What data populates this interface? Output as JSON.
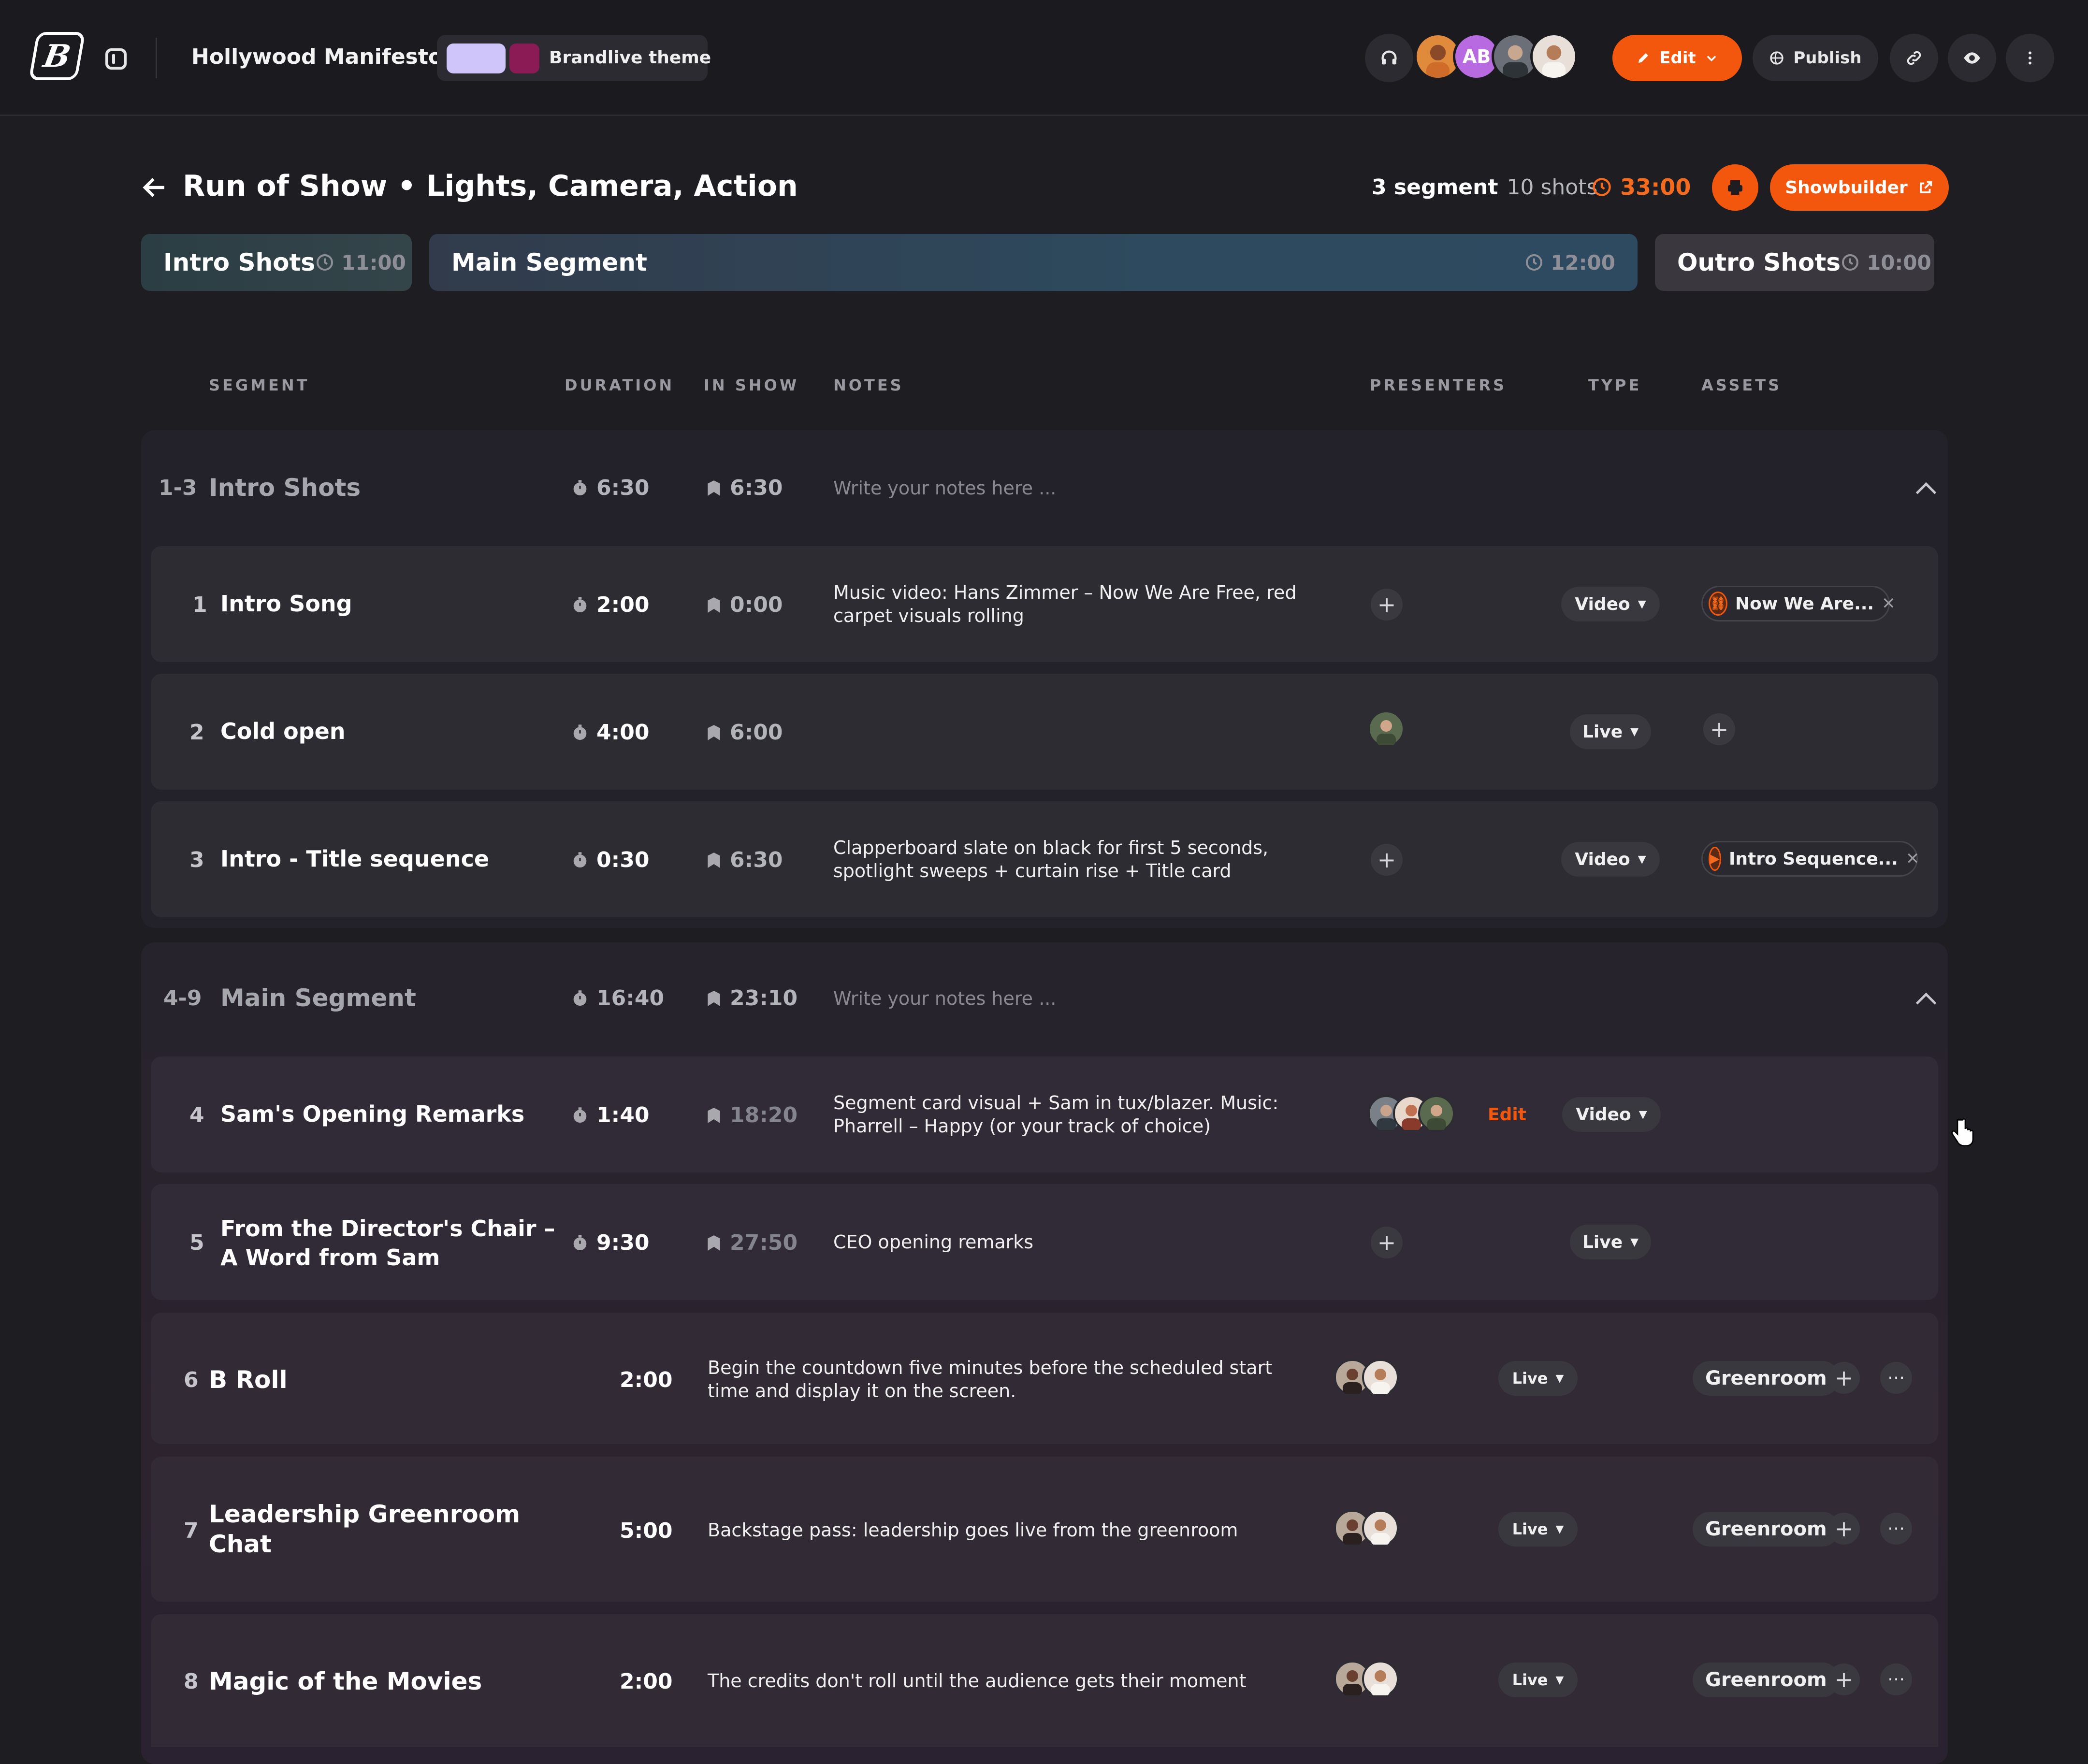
{
  "app": {
    "logo_text": "B",
    "project_title": "Hollywood Manifesto",
    "theme_label": "Brandlive theme",
    "theme_colors": [
      "#d0c5fa",
      "#8a1b55"
    ],
    "avatars": [
      {
        "kind": "photo",
        "color": "#e08a3c"
      },
      {
        "kind": "initials",
        "text": "AB",
        "color": "#b86ae0"
      },
      {
        "kind": "photo",
        "color": "#6a6f78"
      },
      {
        "kind": "photo",
        "color": "#e8e0d8"
      }
    ],
    "edit_label": "Edit",
    "publish_label": "Publish",
    "icons": [
      "headphones-icon",
      "pencil-icon",
      "chevron-down-icon",
      "globe-icon",
      "link-icon",
      "eye-icon",
      "more-vertical-icon"
    ],
    "accent_color": "#f2570d"
  },
  "page": {
    "title": "Run of Show • Lights, Camera, Action",
    "segment_count": "3 segment",
    "shot_count": "10 shots",
    "total_time": "33:00",
    "showbuilder_label": "Showbuilder"
  },
  "segment_tabs": [
    {
      "name": "Intro Shots",
      "time": "11:00"
    },
    {
      "name": "Main Segment",
      "time": "12:00"
    },
    {
      "name": "Outro Shots",
      "time": "10:00"
    }
  ],
  "columns": {
    "segment": "SEGMENT",
    "duration": "DURATION",
    "in_show": "IN SHOW",
    "notes": "NOTES",
    "presenters": "PRESENTERS",
    "type": "TYPE",
    "assets": "ASSETS"
  },
  "groups": [
    {
      "range": "1-3",
      "name": "Intro Shots",
      "duration": "6:30",
      "in_show": "6:30",
      "notes_placeholder": "Write your notes here ..."
    },
    {
      "range": "4-9",
      "name": "Main Segment",
      "duration": "16:40",
      "in_show": "23:10",
      "notes_placeholder": "Write your notes here ..."
    }
  ],
  "rows": [
    {
      "num": "1",
      "name": "Intro Song",
      "duration": "2:00",
      "in_show": "0:00",
      "notes": "Music video: Hans Zimmer – Now We Are Free, red carpet visuals rolling",
      "type": "Video",
      "asset": "Now We Are..."
    },
    {
      "num": "2",
      "name": "Cold open",
      "duration": "4:00",
      "in_show": "6:00",
      "notes": "",
      "type": "Live"
    },
    {
      "num": "3",
      "name": "Intro - Title sequence",
      "duration": "0:30",
      "in_show": "6:30",
      "notes": "Clapperboard slate on black for first 5 seconds, spotlight sweeps + curtain rise + Title card",
      "type": "Video",
      "asset": "Intro Sequence..."
    },
    {
      "num": "4",
      "name": "Sam's Opening Remarks",
      "duration": "1:40",
      "in_show": "18:20",
      "notes": "Segment card visual + Sam in tux/blazer. Music: Pharrell – Happy (or your track of choice)",
      "presenters_edit": "Edit",
      "type": "Video"
    },
    {
      "num": "5",
      "name_line1": "From the Director's Chair –",
      "name_line2": "A Word from Sam",
      "duration": "9:30",
      "in_show": "27:50",
      "notes": "CEO opening remarks",
      "type": "Live"
    },
    {
      "num": "6",
      "name": "B Roll",
      "duration": "2:00",
      "notes": "Begin the countdown five minutes before the scheduled start time and display it on the screen.",
      "type": "Live",
      "asset": "Greenroom"
    },
    {
      "num": "7",
      "name_line1": "Leadership Greenroom",
      "name_line2": "Chat",
      "duration": "5:00",
      "notes": "Backstage pass: leadership goes live from the greenroom",
      "type": "Live",
      "asset": "Greenroom"
    },
    {
      "num": "8",
      "name": "Magic of the Movies",
      "duration": "2:00",
      "notes": "The credits don't roll until the audience gets their moment",
      "type": "Live",
      "asset": "Greenroom"
    }
  ]
}
